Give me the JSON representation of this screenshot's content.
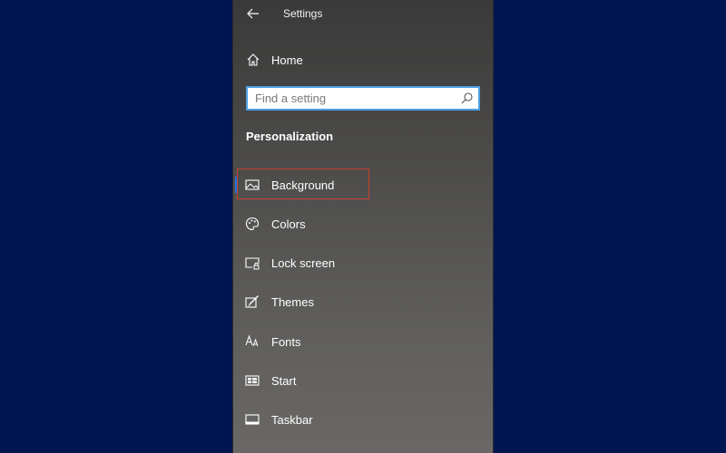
{
  "window": {
    "title": "Settings",
    "back_icon": "back-arrow-icon"
  },
  "home": {
    "label": "Home",
    "icon": "home-icon"
  },
  "search": {
    "placeholder": "Find a setting",
    "value": "",
    "icon": "search-icon"
  },
  "section": {
    "title": "Personalization"
  },
  "nav": {
    "items": [
      {
        "label": "Background",
        "icon": "picture-icon",
        "selected": true
      },
      {
        "label": "Colors",
        "icon": "palette-icon"
      },
      {
        "label": "Lock screen",
        "icon": "lock-screen-icon"
      },
      {
        "label": "Themes",
        "icon": "themes-icon"
      },
      {
        "label": "Fonts",
        "icon": "fonts-icon"
      },
      {
        "label": "Start",
        "icon": "start-icon"
      },
      {
        "label": "Taskbar",
        "icon": "taskbar-icon"
      }
    ]
  },
  "colors": {
    "page_background": "#001650",
    "accent": "#1a73e8",
    "search_focus_border": "#4d9fe6",
    "highlight_box": "#c8402f"
  }
}
